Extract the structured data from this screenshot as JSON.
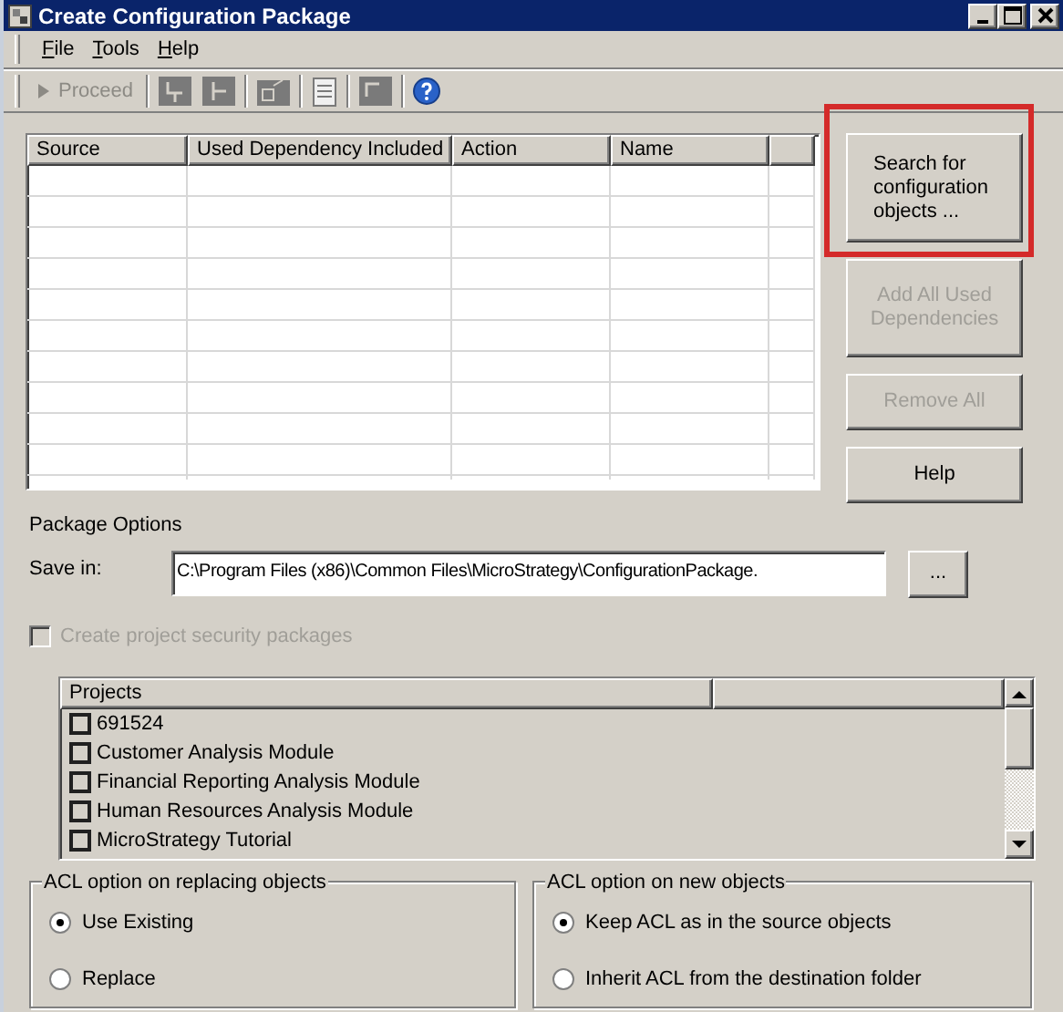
{
  "window": {
    "title": "Create Configuration Package"
  },
  "menu": [
    {
      "label": "File"
    },
    {
      "label": "Tools"
    },
    {
      "label": "Help"
    }
  ],
  "toolbar": {
    "proceed": {
      "label": "Proceed",
      "disabled": true
    }
  },
  "table": {
    "columns": [
      "Source",
      "Used Dependency Included",
      "Action",
      "Name"
    ]
  },
  "buttons": [
    {
      "label": "Search for configuration objects ...",
      "disabled": false,
      "highlighted": true
    },
    {
      "label": "Add All Used Dependencies",
      "disabled": true,
      "highlighted": false
    },
    {
      "label": "Remove All",
      "disabled": true,
      "highlighted": false
    },
    {
      "label": "Help",
      "disabled": false,
      "highlighted": false
    }
  ],
  "package_options": {
    "title": "Package Options",
    "save_in_label": "Save in:",
    "save_in_value": "C:\\Program Files (x86)\\Common Files\\MicroStrategy\\ConfigurationPackage.",
    "browse_button": "...",
    "security_checkbox": {
      "label": "Create project security packages",
      "checked": false,
      "disabled": true
    }
  },
  "projects": {
    "column": "Projects",
    "items": [
      {
        "label": "691524",
        "checked": false
      },
      {
        "label": "Customer Analysis Module",
        "checked": false
      },
      {
        "label": "Financial Reporting Analysis Module",
        "checked": false
      },
      {
        "label": "Human Resources Analysis Module",
        "checked": false
      },
      {
        "label": "MicroStrategy Tutorial",
        "checked": false
      }
    ]
  },
  "acl_groups": [
    {
      "title": "ACL option on replacing objects",
      "options": [
        {
          "label": "Use Existing",
          "selected": true
        },
        {
          "label": "Replace",
          "selected": false
        }
      ]
    },
    {
      "title": "ACL option on new objects",
      "options": [
        {
          "label": "Keep ACL as in the source objects",
          "selected": true
        },
        {
          "label": "Inherit ACL from the destination folder",
          "selected": false
        }
      ]
    }
  ]
}
